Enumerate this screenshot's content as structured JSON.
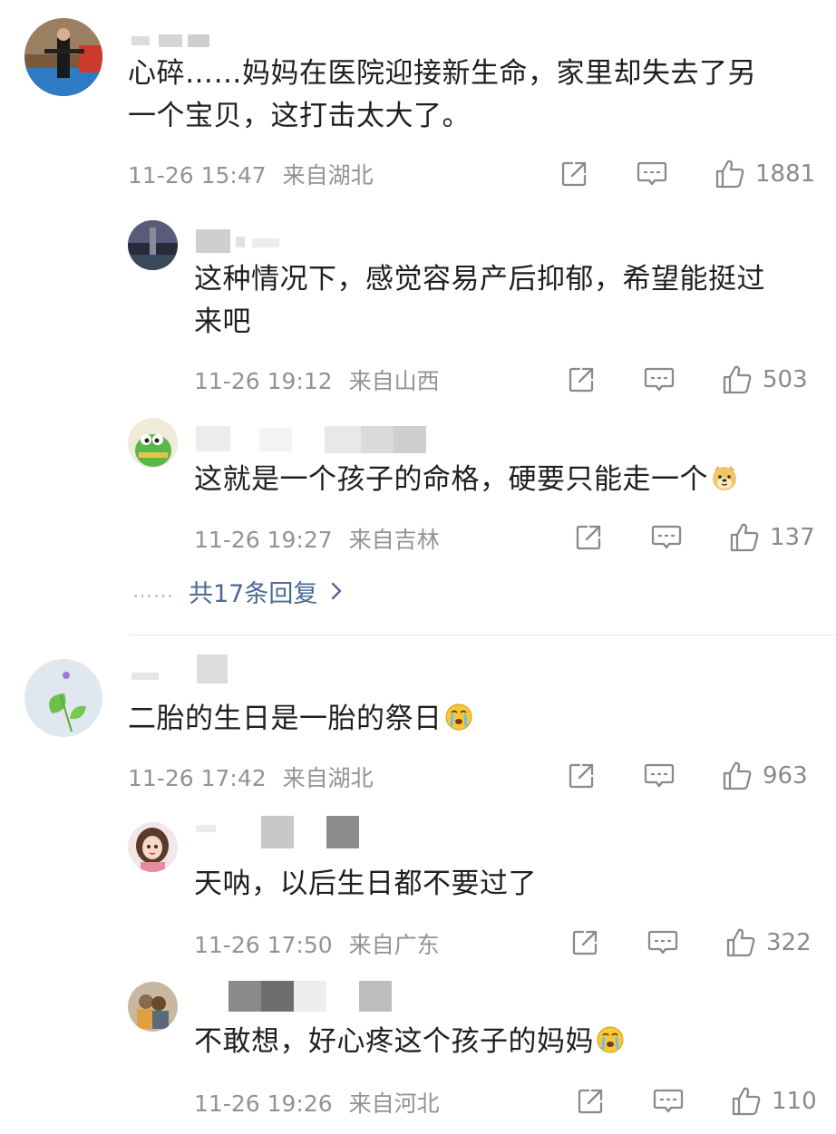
{
  "comments": [
    {
      "text_lines": [
        "心碎……妈妈在医院迎接新生命，家里却失去了另",
        "一个宝贝，这打击太大了。"
      ],
      "time": "11-26 15:47",
      "location": "来自湖北",
      "likes": "1881",
      "replies": [
        {
          "text_lines": [
            "这种情况下，感觉容易产后抑郁，希望能挺过",
            "来吧"
          ],
          "time": "11-26 19:12",
          "location": "来自山西",
          "likes": "503"
        },
        {
          "text": "这就是一个孩子的命格，硬要只能走一个",
          "emoji_icon": "doge-emoji-icon",
          "time": "11-26 19:27",
          "location": "来自吉林",
          "likes": "137"
        }
      ],
      "more_replies": {
        "dots": "……",
        "label": "共17条回复"
      }
    },
    {
      "text": "二胎的生日是一胎的祭日",
      "emoji_icon": "crying-emoji-icon",
      "time": "11-26 17:42",
      "location": "来自湖北",
      "likes": "963",
      "replies": [
        {
          "text": "天呐，以后生日都不要过了",
          "time": "11-26 17:50",
          "location": "来自广东",
          "likes": "322"
        },
        {
          "text": "不敢想，好心疼这个孩子的妈妈",
          "emoji_icon": "crying-emoji-icon",
          "time": "11-26 19:26",
          "location": "来自河北",
          "likes": "110"
        }
      ]
    }
  ],
  "icons": {
    "share": "share-icon",
    "comment": "comment-icon",
    "like": "thumbs-up-icon",
    "more_chevron": "chevron-right-icon"
  },
  "colors": {
    "meta_text": "#939393",
    "link_blue": "#4a6a94",
    "body_text": "#1f1f1f"
  }
}
